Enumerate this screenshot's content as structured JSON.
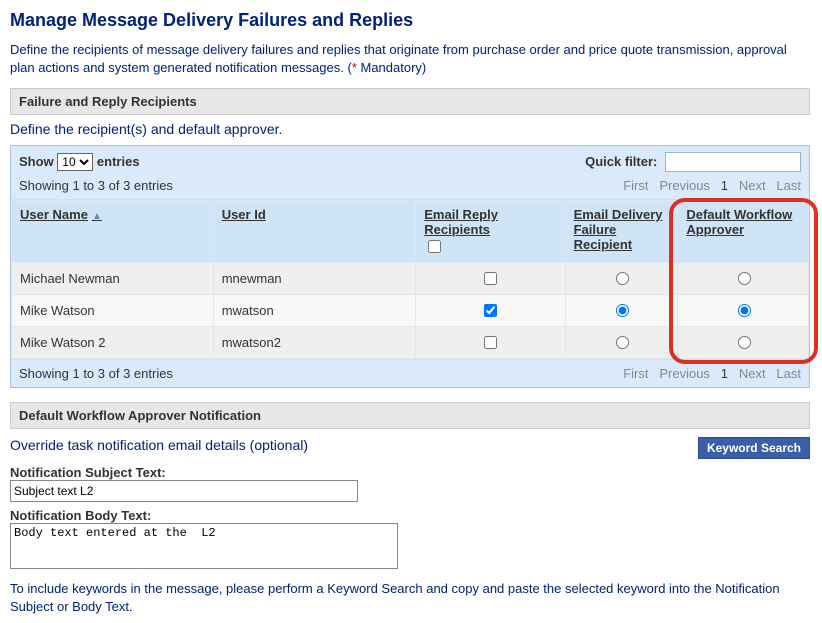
{
  "page_title": "Manage Message Delivery Failures and Replies",
  "intro_text_pre": "Define the recipients of message delivery failures and replies that originate from purchase order and price quote transmission, approval plan actions and system generated notification messages. (",
  "intro_mandatory": " Mandatory)",
  "section1_title": "Failure and Reply Recipients",
  "section1_sub": "Define the recipient(s) and default approver.",
  "show_label_pre": "Show",
  "show_label_post": "entries",
  "show_value": "10",
  "quick_filter_label": "Quick filter:",
  "showing_text": "Showing 1 to 3 of 3 entries",
  "pager": {
    "first": "First",
    "previous": "Previous",
    "page": "1",
    "next": "Next",
    "last": "Last"
  },
  "columns": {
    "user_name": "User Name",
    "user_id": "User Id",
    "email_reply": "Email Reply Recipients",
    "email_fail": "Email Delivery Failure Recipient",
    "approver": "Default Workflow Approver"
  },
  "rows": [
    {
      "user_name": "Michael Newman",
      "user_id": "mnewman",
      "email_reply": false,
      "email_fail": false,
      "approver": false
    },
    {
      "user_name": "Mike Watson",
      "user_id": "mwatson",
      "email_reply": true,
      "email_fail": true,
      "approver": true
    },
    {
      "user_name": "Mike Watson 2",
      "user_id": "mwatson2",
      "email_reply": false,
      "email_fail": false,
      "approver": false
    }
  ],
  "section2_title": "Default Workflow Approver Notification",
  "section2_sub": "Override task notification email details (optional)",
  "keyword_search_label": "Keyword Search",
  "subject_label": "Notification Subject Text:",
  "subject_value": "Subject text L2",
  "body_label": "Notification Body Text:",
  "body_value": "Body text entered at the  L2",
  "hint_text": "To include keywords in the message, please perform a Keyword Search and copy and paste the selected keyword into the Notification Subject or Body Text."
}
